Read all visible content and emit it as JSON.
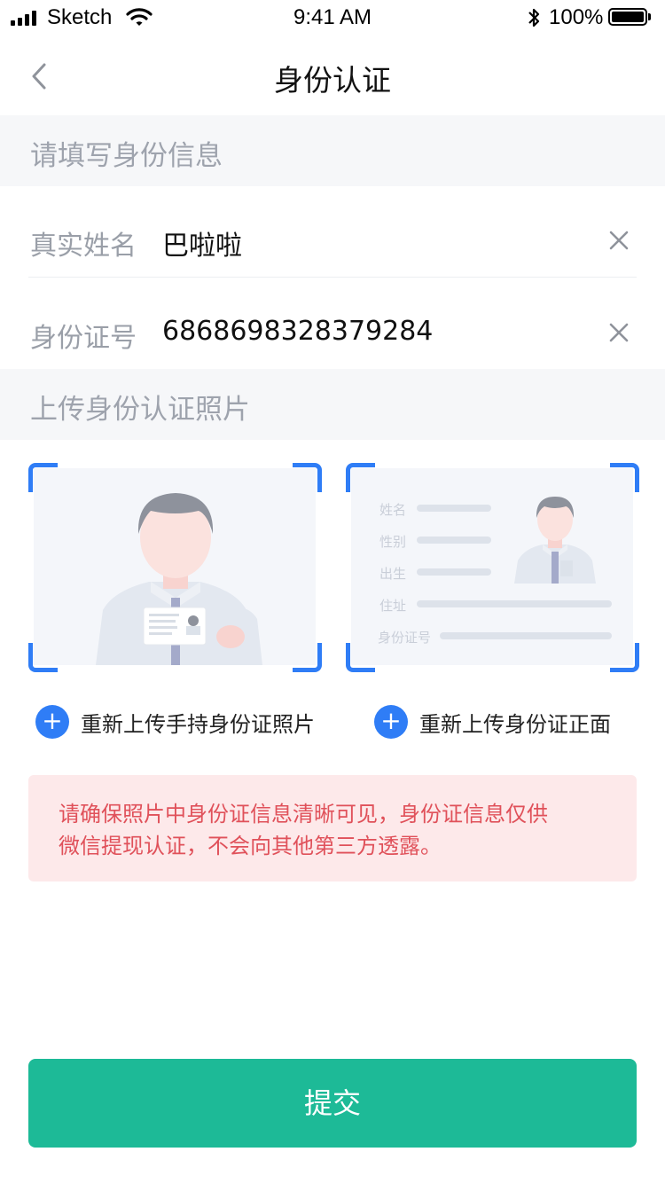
{
  "status_bar": {
    "carrier": "Sketch",
    "time": "9:41 AM",
    "bluetooth_icon": "bluetooth-icon",
    "battery_percent": "100%"
  },
  "nav": {
    "title": "身份认证",
    "back_icon": "chevron-left-icon"
  },
  "sections": {
    "identity": "请填写身份信息",
    "photos": "上传身份认证照片"
  },
  "form": {
    "name": {
      "label": "真实姓名",
      "value": "巴啦啦",
      "clear_icon": "close-icon"
    },
    "id_number": {
      "label": "身份证号",
      "value": "6868698328379284",
      "clear_icon": "close-icon"
    }
  },
  "id_card_illustration": {
    "labels": [
      "姓名",
      "性别",
      "出生",
      "住址",
      "身份证号"
    ]
  },
  "uploads": {
    "handheld": {
      "label": "重新上传手持身份证照片",
      "icon": "plus-circle-icon"
    },
    "front": {
      "label": "重新上传身份证正面",
      "icon": "plus-circle-icon"
    }
  },
  "notice": {
    "line1": "请确保照片中身份证信息清晰可见，身份证信息仅供",
    "line2": "微信提现认证，不会向其他第三方透露。"
  },
  "submit_label": "提交",
  "colors": {
    "accent_blue": "#2f7df6",
    "submit_green": "#1dba97",
    "notice_bg": "#fde9ea",
    "notice_text": "#e0515a",
    "section_bg": "#f6f7f9"
  }
}
